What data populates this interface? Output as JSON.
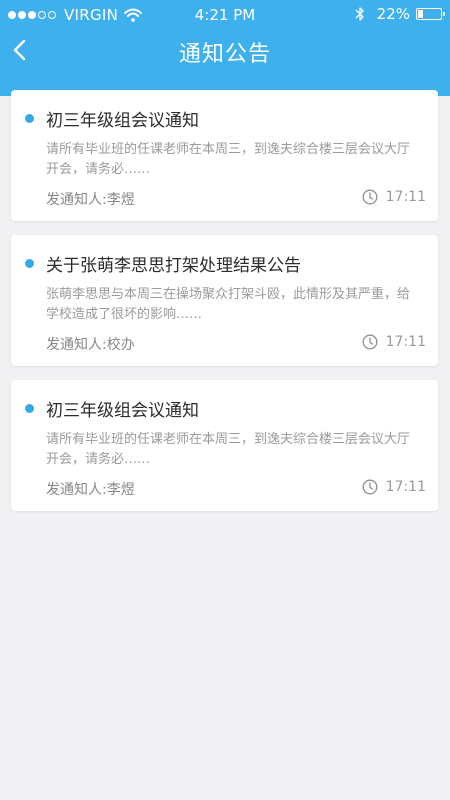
{
  "status_bar": {
    "carrier": "VIRGIN",
    "time": "4:21 PM",
    "battery_pct": "22%",
    "battery_level": 0.22,
    "signal_bars_filled": 3,
    "signal_bars_total": 5
  },
  "nav": {
    "title": "通知公告",
    "back_icon": "chevron-left-icon"
  },
  "colors": {
    "header": "#3fb0ee",
    "bullet": "#35a8ec",
    "background": "#f1f1f3"
  },
  "notices": [
    {
      "title": "初三年级组会议通知",
      "body": "请所有毕业班的任课老师在本周三，到逸夫综合楼三层会议大厅开会，请务必……",
      "sender": "发通知人:李煜",
      "time": "17:11"
    },
    {
      "title": "关于张萌李思思打架处理结果公告",
      "body": "张萌李思思与本周三在操场聚众打架斗殴，此情形及其严重，给学校造成了很坏的影响……",
      "sender": "发通知人:校办",
      "time": "17:11"
    },
    {
      "title": "初三年级组会议通知",
      "body": "请所有毕业班的任课老师在本周三，到逸夫综合楼三层会议大厅开会，请务必……",
      "sender": "发通知人:李煜",
      "time": "17:11"
    }
  ]
}
